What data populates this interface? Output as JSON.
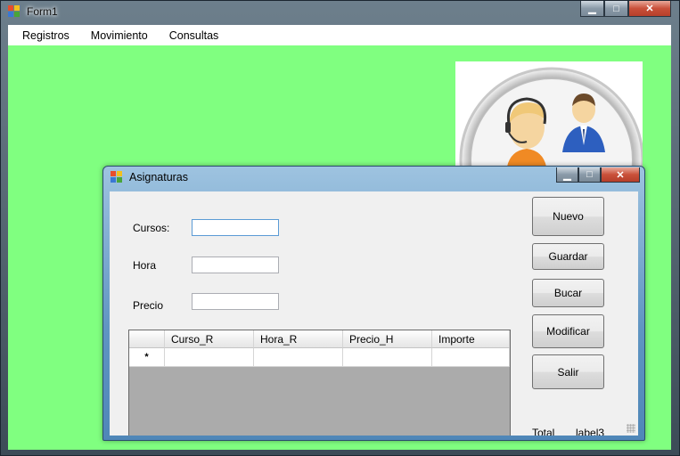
{
  "window": {
    "title": "Form1"
  },
  "menu": [
    "Registros",
    "Movimiento",
    "Consultas"
  ],
  "dialog": {
    "title": "Asignaturas",
    "fields": [
      {
        "label": "Cursos:",
        "value": ""
      },
      {
        "label": "Hora",
        "value": ""
      },
      {
        "label": "Precio",
        "value": ""
      }
    ],
    "buttons": [
      "Nuevo",
      "Guardar",
      "Bucar",
      "Modificar",
      "Salir"
    ],
    "grid": {
      "columns": [
        "Curso_R",
        "Hora_R",
        "Precio_H",
        "Importe"
      ],
      "new_row_marker": "*"
    },
    "total_label": "Total",
    "total_value": "label3"
  },
  "colors": {
    "client_background": "#80ff80",
    "dialog_frame": "#5f95c2"
  },
  "icons": {
    "app": "app-form-icon",
    "minimize": "minimize-icon",
    "maximize": "maximize-icon",
    "close": "close-icon"
  }
}
